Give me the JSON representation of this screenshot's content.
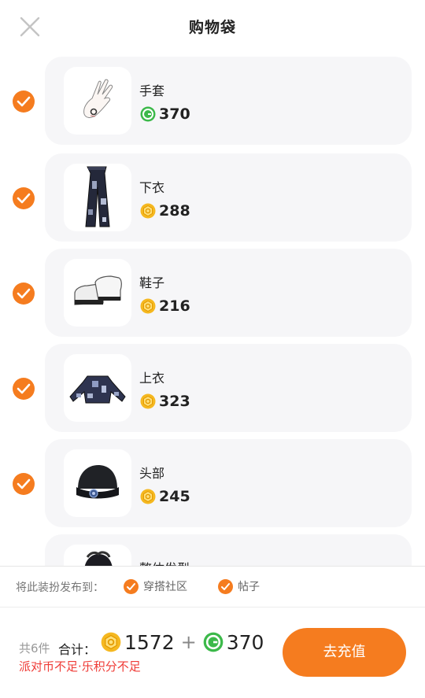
{
  "header": {
    "title": "购物袋",
    "close_icon": "close-icon"
  },
  "items": [
    {
      "name": "手套",
      "price": "370",
      "currency": "green-coin",
      "checked": true,
      "image": "gloves"
    },
    {
      "name": "下衣",
      "price": "288",
      "currency": "gold-coin",
      "checked": true,
      "image": "pants"
    },
    {
      "name": "鞋子",
      "price": "216",
      "currency": "gold-coin",
      "checked": true,
      "image": "shoes"
    },
    {
      "name": "上衣",
      "price": "323",
      "currency": "gold-coin",
      "checked": true,
      "image": "jacket"
    },
    {
      "name": "头部",
      "price": "245",
      "currency": "gold-coin",
      "checked": true,
      "image": "beanie"
    },
    {
      "name": "整体发型",
      "price": "",
      "currency": "gold-coin",
      "checked": true,
      "image": "hairstyle"
    }
  ],
  "publish": {
    "label": "将此装扮发布到：",
    "options": [
      {
        "label": "穿搭社区",
        "checked": true
      },
      {
        "label": "帖子",
        "checked": true
      }
    ]
  },
  "footer": {
    "count_label": "共6件",
    "total_label": "合计：",
    "gold_total": "1572",
    "plus": "+",
    "green_total": "370",
    "warning": "派对币不足·乐积分不足",
    "recharge_label": "去充值"
  },
  "colors": {
    "accent": "#f57c1f",
    "warning": "#ef3b36",
    "gold_coin": "#f5b820",
    "green_coin": "#3cb94a",
    "card_bg": "#f6f6f8"
  }
}
